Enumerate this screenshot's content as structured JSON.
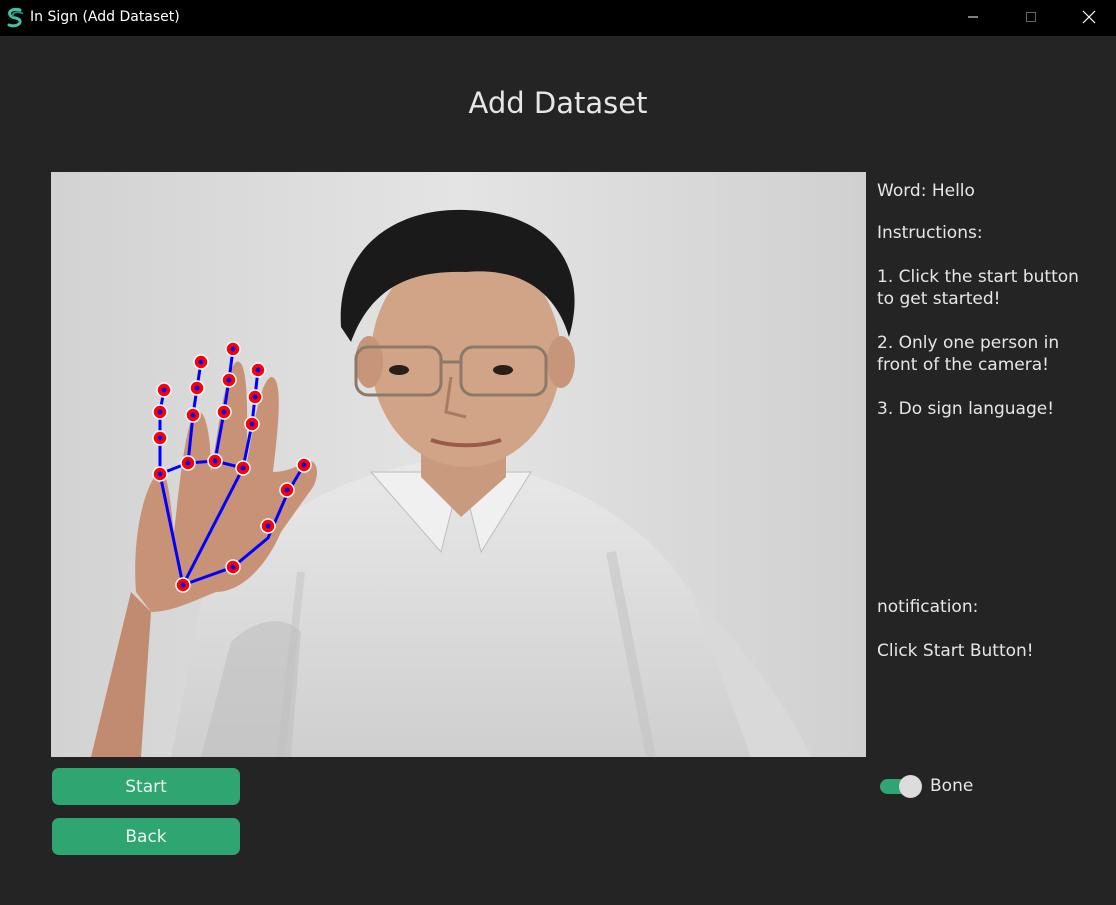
{
  "window": {
    "title": "In Sign (Add Dataset)",
    "app_icon": "in-sign-logo-icon",
    "controls": [
      "minimize-icon",
      "maximize-icon",
      "close-icon"
    ]
  },
  "page": {
    "title": "Add Dataset"
  },
  "camera": {
    "content": "webcam feed with hand landmark skeleton overlay",
    "skeleton_line_color": "#0000ff",
    "landmark_color": "#ff0000"
  },
  "info_panel": {
    "word": "Word: Hello",
    "instructions_heading": "Instructions:",
    "steps": [
      "1. Click the start button to get started!",
      "2. Only one person in front of the camera!",
      "3. Do sign language!"
    ],
    "notification_label": "notification:",
    "notification_text": "Click Start Button!"
  },
  "buttons": {
    "start": "Start",
    "back": "Back"
  },
  "toggle": {
    "label": "Bone",
    "on": true
  },
  "colors": {
    "background": "#242424",
    "titlebar": "#000000",
    "accent": "#2fa572",
    "text": "#e6e6e6"
  }
}
